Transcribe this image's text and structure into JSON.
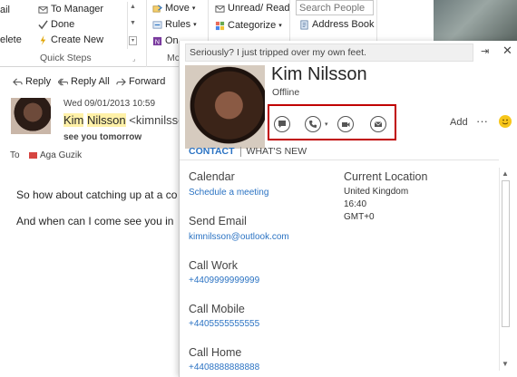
{
  "ribbon": {
    "quick_steps": {
      "items": [
        {
          "label": "ail"
        },
        {
          "label": "To Manager"
        },
        {
          "label": "Done"
        },
        {
          "label": "elete"
        },
        {
          "label": "Create New"
        }
      ],
      "group_label": "Quick Steps"
    },
    "move": {
      "move_label": "Move",
      "rules_label": "Rules",
      "onenote_label": "On",
      "group_label": "Mc"
    },
    "tags": {
      "unread_label": "Unread/ Read",
      "categorize_label": "Categorize"
    },
    "find": {
      "search_placeholder": "Search People",
      "address_book_label": "Address Book"
    }
  },
  "message": {
    "actions": {
      "reply": "Reply",
      "reply_all": "Reply All",
      "forward": "Forward"
    },
    "date": "Wed 09/01/2013 10:59",
    "sender_first": "Kim",
    "sender_last": "Nilsson",
    "sender_email_partial": "<kimnilsso",
    "subject": "see you tomorrow",
    "to_label": "To",
    "recipient": "Aga Guzik",
    "body_line1": "So how about catching up at a co",
    "body_line2": "And when can I come see you in"
  },
  "contact_card": {
    "note": "Seriously? I just tripped over my own feet.",
    "name": "Kim Nilsson",
    "status": "Offline",
    "add_label": "Add",
    "more_label": "···",
    "tabs": [
      {
        "label": "CONTACT",
        "active": true
      },
      {
        "label": "WHAT'S NEW",
        "active": false
      }
    ],
    "fields": {
      "calendar_title": "Calendar",
      "calendar_link": "Schedule a meeting",
      "email_title": "Send Email",
      "email_value": "kimnilsson@outlook.com",
      "work_title": "Call Work",
      "work_value": "+4409999999999",
      "mobile_title": "Call Mobile",
      "mobile_value": "+4405555555555",
      "home_title": "Call Home",
      "home_value": "+4408888888888",
      "location_title": "Current Location",
      "location_country": "United Kingdom",
      "location_time": "16:40",
      "location_tz": "GMT+0"
    }
  },
  "colors": {
    "accent": "#2b73c3",
    "highlight_box": "#c00000",
    "highlight_text": "#fff1a8",
    "status_icon": "#f7c61a"
  },
  "icons": [
    "checkmark-icon",
    "lightning-icon",
    "envelope-icon",
    "move-icon",
    "rules-icon",
    "onenote-icon",
    "category-icon",
    "address-book-icon",
    "reply-icon",
    "reply-all-icon",
    "forward-icon",
    "flag-icon",
    "chat-icon",
    "phone-icon",
    "video-icon",
    "email-icon",
    "pin-icon",
    "close-icon",
    "smiley-icon"
  ]
}
